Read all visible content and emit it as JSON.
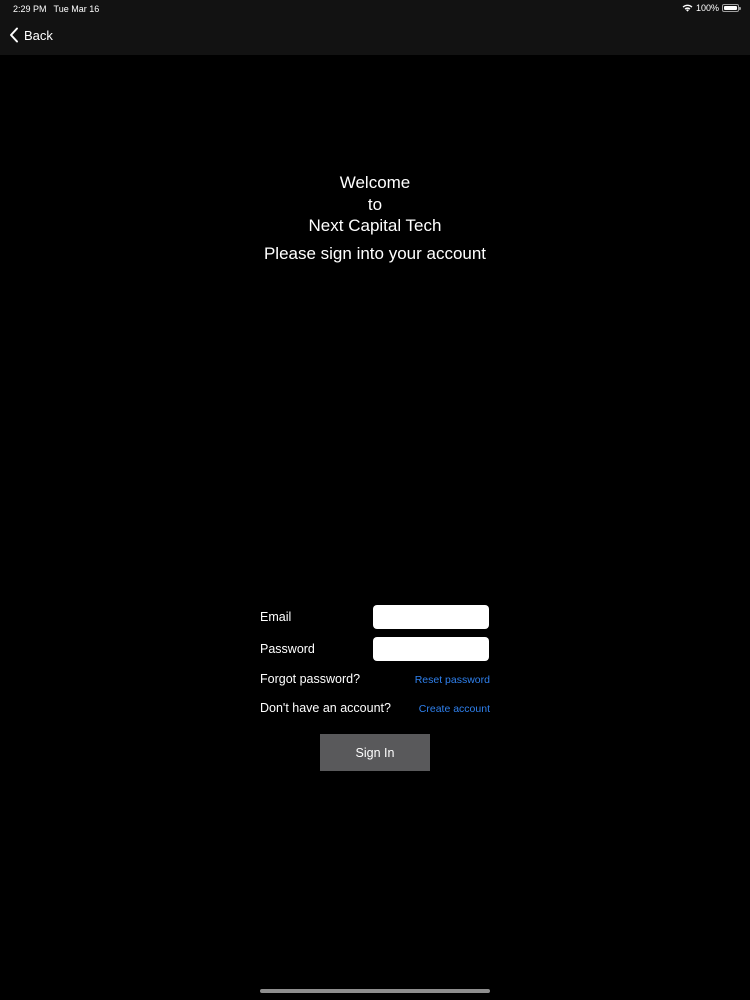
{
  "status_bar": {
    "time": "2:29 PM",
    "date": "Tue Mar 16",
    "battery": "100%",
    "icons": [
      "wifi-icon",
      "battery-icon"
    ]
  },
  "nav": {
    "back_label": "Back",
    "back_icon": "chevron-left-icon"
  },
  "welcome": {
    "line1": "Welcome",
    "line2": "to",
    "line3": "Next Capital Tech",
    "subtitle": "Please sign into your account"
  },
  "form": {
    "email_label": "Email",
    "email_value": "",
    "password_label": "Password",
    "password_value": "",
    "forgot_text": "Forgot password?",
    "reset_link": "Reset password",
    "no_account_text": "Don't have an account?",
    "create_link": "Create account",
    "sign_in_label": "Sign In"
  },
  "colors": {
    "background": "#000000",
    "bar_background": "#121212",
    "link": "#2f80ed",
    "button": "#59595b"
  }
}
